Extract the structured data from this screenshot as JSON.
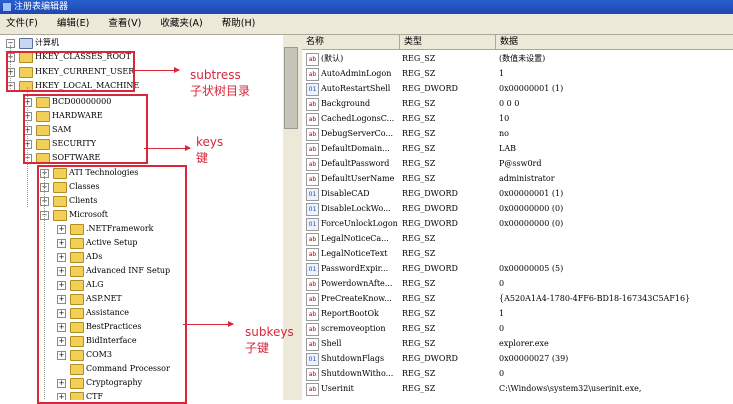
{
  "window": {
    "title": "注册表编辑器"
  },
  "menu": [
    "文件(F)",
    "编辑(E)",
    "查看(V)",
    "收藏夹(A)",
    "帮助(H)"
  ],
  "tree": [
    {
      "label": "计算机",
      "box": "−"
    },
    {
      "label": "HKEY_CLASSES_ROOT",
      "box": "+"
    },
    {
      "label": "HKEY_CURRENT_USER",
      "box": "+"
    },
    {
      "label": "HKEY_LOCAL_MACHINE",
      "box": "−"
    },
    {
      "label": "BCD00000000",
      "box": "+"
    },
    {
      "label": "HARDWARE",
      "box": "+"
    },
    {
      "label": "SAM",
      "box": "+"
    },
    {
      "label": "SECURITY",
      "box": "+"
    },
    {
      "label": "SOFTWARE",
      "box": "−"
    },
    {
      "label": "ATI Technologies",
      "box": "+"
    },
    {
      "label": "Classes",
      "box": "+"
    },
    {
      "label": "Clients",
      "box": "+"
    },
    {
      "label": "Microsoft",
      "box": "−"
    },
    {
      "label": ".NETFramework",
      "box": "+"
    },
    {
      "label": "Active Setup",
      "box": "+"
    },
    {
      "label": "ADs",
      "box": "+"
    },
    {
      "label": "Advanced INF Setup",
      "box": "+"
    },
    {
      "label": "ALG",
      "box": "+"
    },
    {
      "label": "ASP.NET",
      "box": "+"
    },
    {
      "label": "Assistance",
      "box": "+"
    },
    {
      "label": "BestPractices",
      "box": "+"
    },
    {
      "label": "BidInterface",
      "box": "+"
    },
    {
      "label": "COM3",
      "box": "+"
    },
    {
      "label": "Command Processor",
      "box": ""
    },
    {
      "label": "Cryptography",
      "box": "+"
    },
    {
      "label": "CTF",
      "box": "+"
    }
  ],
  "list": {
    "columns": [
      "名称",
      "类型",
      "数据"
    ],
    "rows": [
      {
        "name": "(默认)",
        "type": "REG_SZ",
        "data": "(数值未设置)",
        "kind": "ab"
      },
      {
        "name": "AutoAdminLogon",
        "type": "REG_SZ",
        "data": "1",
        "kind": "ab"
      },
      {
        "name": "AutoRestartShell",
        "type": "REG_DWORD",
        "data": "0x00000001 (1)",
        "kind": "bin"
      },
      {
        "name": "Background",
        "type": "REG_SZ",
        "data": "0 0 0",
        "kind": "ab"
      },
      {
        "name": "CachedLogonsC...",
        "type": "REG_SZ",
        "data": "10",
        "kind": "ab"
      },
      {
        "name": "DebugServerCo...",
        "type": "REG_SZ",
        "data": "no",
        "kind": "ab"
      },
      {
        "name": "DefaultDomain...",
        "type": "REG_SZ",
        "data": "LAB",
        "kind": "ab"
      },
      {
        "name": "DefaultPassword",
        "type": "REG_SZ",
        "data": "P@ssw0rd",
        "kind": "ab"
      },
      {
        "name": "DefaultUserName",
        "type": "REG_SZ",
        "data": "administrator",
        "kind": "ab"
      },
      {
        "name": "DisableCAD",
        "type": "REG_DWORD",
        "data": "0x00000001 (1)",
        "kind": "bin"
      },
      {
        "name": "DisableLockWo...",
        "type": "REG_DWORD",
        "data": "0x00000000 (0)",
        "kind": "bin"
      },
      {
        "name": "ForceUnlockLogon",
        "type": "REG_DWORD",
        "data": "0x00000000 (0)",
        "kind": "bin"
      },
      {
        "name": "LegalNoticeCa...",
        "type": "REG_SZ",
        "data": "",
        "kind": "ab"
      },
      {
        "name": "LegalNoticeText",
        "type": "REG_SZ",
        "data": "",
        "kind": "ab"
      },
      {
        "name": "PasswordExpir...",
        "type": "REG_DWORD",
        "data": "0x00000005 (5)",
        "kind": "bin"
      },
      {
        "name": "PowerdownAfte...",
        "type": "REG_SZ",
        "data": "0",
        "kind": "ab"
      },
      {
        "name": "PreCreateKnow...",
        "type": "REG_SZ",
        "data": "{A520A1A4-1780-4FF6-BD18-167343C5AF16}",
        "kind": "ab"
      },
      {
        "name": "ReportBootOk",
        "type": "REG_SZ",
        "data": "1",
        "kind": "ab"
      },
      {
        "name": "scremoveoption",
        "type": "REG_SZ",
        "data": "0",
        "kind": "ab"
      },
      {
        "name": "Shell",
        "type": "REG_SZ",
        "data": "explorer.exe",
        "kind": "ab"
      },
      {
        "name": "ShutdownFlags",
        "type": "REG_DWORD",
        "data": "0x00000027 (39)",
        "kind": "bin"
      },
      {
        "name": "ShutdownWitho...",
        "type": "REG_SZ",
        "data": "0",
        "kind": "ab"
      },
      {
        "name": "Userinit",
        "type": "REG_SZ",
        "data": "C:\\Windows\\system32\\userinit.exe,",
        "kind": "ab"
      }
    ]
  },
  "annotations": {
    "subtress": "subtress",
    "subtress_cn": "子状树目录",
    "keys": "keys",
    "keys_cn": "键",
    "subkeys": "subkeys",
    "subkeys_cn": "子键",
    "color": "#d8263b"
  }
}
